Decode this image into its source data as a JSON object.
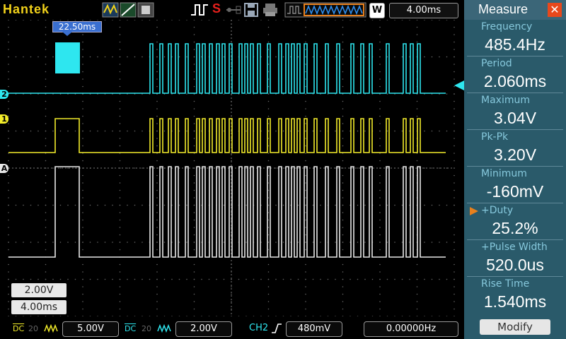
{
  "brand": "Hantek",
  "toolbar": {
    "run_status": "S",
    "timebase": "4.00ms",
    "trigger_mode": "W"
  },
  "screen": {
    "trigger_offset_marker": "22.50ms",
    "ch_labels": [
      "2",
      "1",
      "A"
    ],
    "scale_volts": "2.00V",
    "scale_time": "4.00ms"
  },
  "bottom": {
    "ch1_scale": "5.00V",
    "ch2_scale": "2.00V",
    "trigger_source": "CH2",
    "trigger_level": "480mV",
    "frequency_counter": "0.00000Hz",
    "coupling_ch1": "DC",
    "coupling_ch2": "DC",
    "bw_ch1": "20",
    "bw_ch2": "20"
  },
  "measure": {
    "title": "Measure",
    "items": [
      {
        "name": "Frequency",
        "value": "485.4Hz"
      },
      {
        "name": "Period",
        "value": "2.060ms"
      },
      {
        "name": "Maximum",
        "value": "3.04V"
      },
      {
        "name": "Pk-Pk",
        "value": "3.20V"
      },
      {
        "name": "Minimum",
        "value": "-160mV"
      },
      {
        "name": "+Duty",
        "value": "25.2%"
      },
      {
        "name": "+Pulse Width",
        "value": "520.0us"
      },
      {
        "name": "Rise Time",
        "value": "1.540ms"
      }
    ],
    "modify_label": "Modify"
  },
  "colors": {
    "ch1": "#f2ec2a",
    "ch2": "#2ee6ef",
    "math": "#e8e8e8",
    "accent": "#e8481c",
    "panel": "#2a5a6a"
  }
}
